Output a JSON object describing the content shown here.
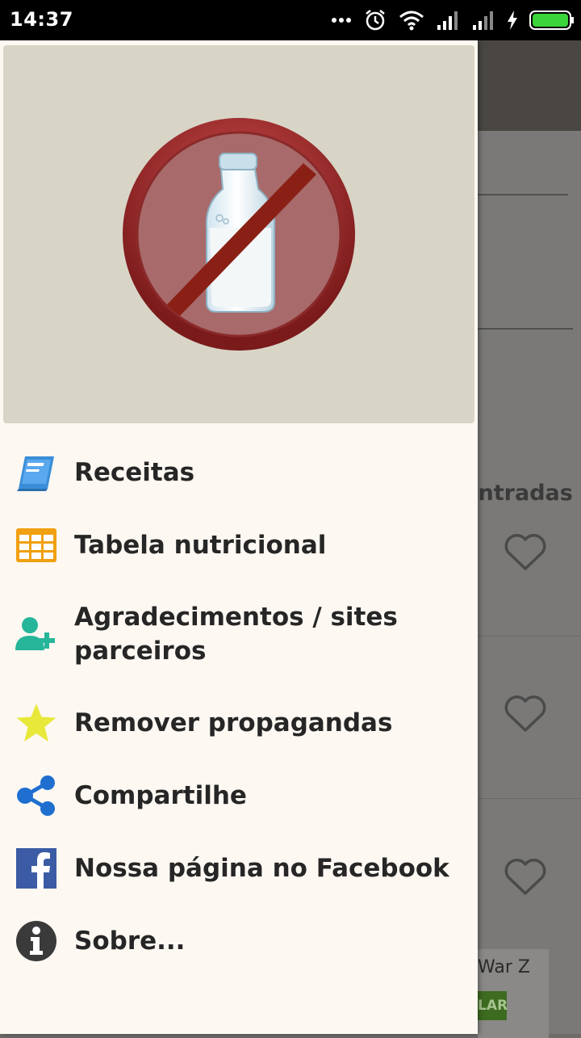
{
  "status_bar": {
    "time": "14:37"
  },
  "background": {
    "partial_heading": "ontradas",
    "ad_text": "War Z",
    "ad_button": "LAR"
  },
  "drawer": {
    "header_image": "no-milk-bottle-icon",
    "items": [
      {
        "label": "Receitas",
        "icon": "book-icon",
        "color": "#3a8ed8"
      },
      {
        "label": "Tabela nutricional",
        "icon": "table-grid-icon",
        "color": "#f0a010"
      },
      {
        "label": "Agradecimentos / sites parceiros",
        "icon": "add-user-icon",
        "color": "#27b59a"
      },
      {
        "label": "Remover propagandas",
        "icon": "star-icon",
        "color": "#e8e83a"
      },
      {
        "label": "Compartilhe",
        "icon": "share-icon",
        "color": "#1e6fd0"
      },
      {
        "label": "Nossa página no Facebook",
        "icon": "facebook-icon",
        "color": "#3b5ba5"
      },
      {
        "label": "Sobre...",
        "icon": "info-icon",
        "color": "#3a3a3a"
      }
    ]
  }
}
